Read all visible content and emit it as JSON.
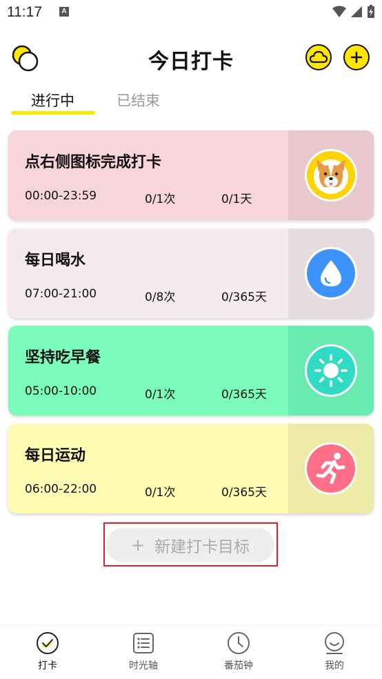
{
  "status_bar": {
    "time": "11:17",
    "notification_letter": "A"
  },
  "header": {
    "title": "今日打卡"
  },
  "tabs": [
    {
      "label": "进行中",
      "active": true
    },
    {
      "label": "已结束",
      "active": false
    }
  ],
  "cards": [
    {
      "title": "点右侧图标完成打卡",
      "time": "00:00-23:59",
      "count": "0/1次",
      "days": "0/1天",
      "bg": "#F7D5DB",
      "side_bg": "#E8C7CD",
      "icon": "corgi-dog-icon",
      "icon_bg": "#FFD400"
    },
    {
      "title": "每日喝水",
      "time": "07:00-21:00",
      "count": "0/8次",
      "days": "0/365天",
      "bg": "#F5EBEE",
      "side_bg": "#E6DCDF",
      "icon": "water-drop-icon",
      "icon_bg": "#3C93FA"
    },
    {
      "title": "坚持吃早餐",
      "time": "05:00-10:00",
      "count": "0/1次",
      "days": "0/365天",
      "bg": "#7CFCBB",
      "side_bg": "#69EAB0",
      "icon": "sun-icon",
      "icon_bg": "#2FDCC3"
    },
    {
      "title": "每日运动",
      "time": "06:00-22:00",
      "count": "0/1次",
      "days": "0/365天",
      "bg": "#FFFDB4",
      "side_bg": "#EEEBA6",
      "icon": "running-person-icon",
      "icon_bg": "#FF6E87"
    }
  ],
  "new_goal": {
    "plus": "+",
    "label": "新建打卡目标"
  },
  "bottom_nav": [
    {
      "label": "打卡",
      "icon": "checkin-icon",
      "active": true
    },
    {
      "label": "时光轴",
      "icon": "timeline-list-icon",
      "active": false
    },
    {
      "label": "番茄钟",
      "icon": "clock-icon",
      "active": false
    },
    {
      "label": "我的",
      "icon": "profile-smile-icon",
      "active": false
    }
  ],
  "colors": {
    "accent": "#FFE600",
    "highlight_frame": "#E02020"
  }
}
